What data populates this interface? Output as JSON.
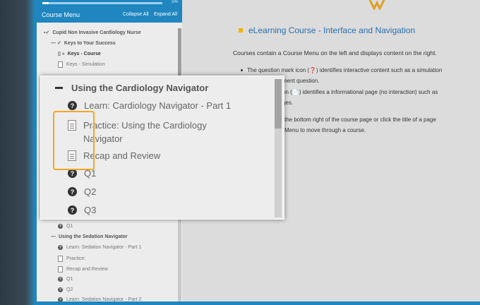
{
  "progress": {
    "label": "5%",
    "fraction": 0.05
  },
  "menu": {
    "title": "Course Menu",
    "collapse_all": "Collapse All",
    "expand_all": "Expand All",
    "items": [
      {
        "label": "Cupid Non Invasive Cardiology Nurse",
        "icon": "book-icon"
      },
      {
        "label": "Keys to Your Success",
        "icon": "collapse-icon"
      },
      {
        "label": "Keys - Course",
        "icon": "page-icon"
      },
      {
        "label": "Keys - Simulation",
        "icon": "page-icon"
      },
      {
        "label": "Q1",
        "icon": "question-icon"
      },
      {
        "label": "Using the Sedation Navigator",
        "icon": "collapse-icon"
      },
      {
        "label": "Learn: Sedation Navigator - Part 1",
        "icon": "question-icon"
      },
      {
        "label": "Practice:",
        "icon": "document-icon"
      },
      {
        "label": "Recap and Review",
        "icon": "document-icon"
      },
      {
        "label": "Q1",
        "icon": "question-icon"
      },
      {
        "label": "Q2",
        "icon": "question-icon"
      },
      {
        "label": "Learn: Sedation Navigator - Part 2",
        "icon": "question-icon"
      }
    ]
  },
  "content": {
    "heading": "eLearning Course - Interface and Navigation",
    "intro": "Courses contain a Course Menu on the left and displays content on the right.",
    "bullets": [
      [
        "The question mark icon (❓) identifies interactive content such as a simulation",
        "ment question."
      ],
      [
        "on (📄) identifies a informational page (no interaction) such as",
        "ges."
      ],
      [
        "the bottom right of the course page or click the title of a page",
        "Menu to move through a course."
      ]
    ]
  },
  "zoom": {
    "section": "Using the Cardiology Navigator",
    "items": [
      {
        "label": "Learn: Cardiology Navigator - Part 1",
        "icon": "question-icon"
      },
      {
        "label_line1": "Practice: Using the Cardiology",
        "label_line2": "Navigator",
        "icon": "document-icon"
      },
      {
        "label": "Recap and Review",
        "icon": "document-icon"
      },
      {
        "label": "Q1",
        "icon": "question-icon"
      },
      {
        "label": "Q2",
        "icon": "question-icon"
      },
      {
        "label": "Q3",
        "icon": "question-icon"
      }
    ]
  },
  "colors": {
    "accent": "#1f86bf",
    "highlight": "#f5a623",
    "heading": "#2a6fb0"
  }
}
